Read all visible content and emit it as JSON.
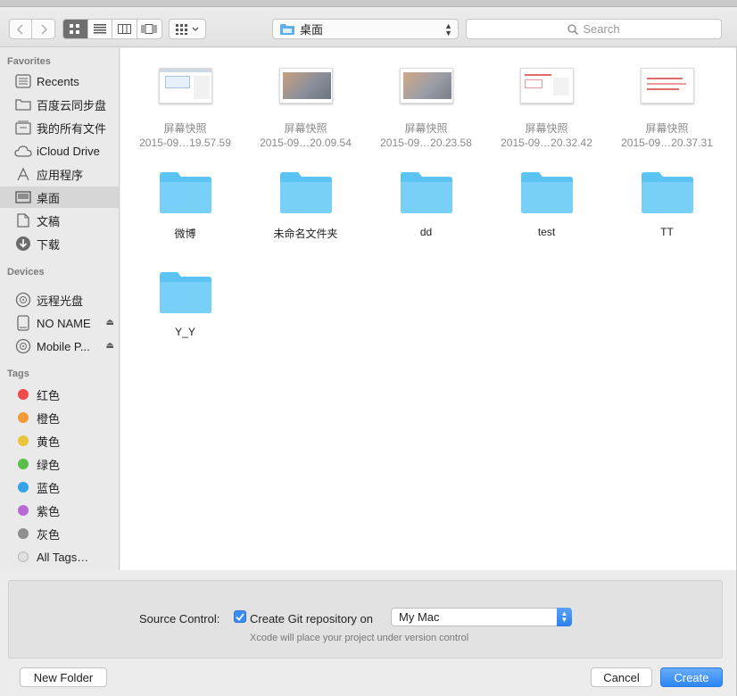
{
  "toolbar": {
    "path_label": "桌面",
    "search_placeholder": "Search"
  },
  "sidebar": {
    "favorites_title": "Favorites",
    "favorites": [
      {
        "label": "Recents",
        "icon": "recents-icon"
      },
      {
        "label": "百度云同步盘",
        "icon": "folder-icon"
      },
      {
        "label": "我的所有文件",
        "icon": "all-files-icon"
      },
      {
        "label": "iCloud Drive",
        "icon": "cloud-icon"
      },
      {
        "label": "应用程序",
        "icon": "applications-icon"
      },
      {
        "label": "桌面",
        "icon": "desktop-icon",
        "selected": true
      },
      {
        "label": "文稿",
        "icon": "documents-icon"
      },
      {
        "label": "下载",
        "icon": "downloads-icon"
      }
    ],
    "devices_title": "Devices",
    "devices": [
      {
        "label": "远程光盘",
        "icon": "disc-icon"
      },
      {
        "label": "NO NAME",
        "icon": "drive-icon",
        "eject": true
      },
      {
        "label": "Mobile P...",
        "icon": "disc-icon",
        "eject": true
      }
    ],
    "tags_title": "Tags",
    "tags": [
      {
        "label": "红色",
        "color": "#ef4a4a"
      },
      {
        "label": "橙色",
        "color": "#f19a37"
      },
      {
        "label": "黄色",
        "color": "#e9c53b"
      },
      {
        "label": "绿色",
        "color": "#5dbd4b"
      },
      {
        "label": "蓝色",
        "color": "#35a3e8"
      },
      {
        "label": "紫色",
        "color": "#b86ad2"
      },
      {
        "label": "灰色",
        "color": "#8e8e8e"
      },
      {
        "label": "All Tags…",
        "color": "#e0e0e0"
      }
    ]
  },
  "files": [
    {
      "name": "屏幕快照",
      "date": "2015-09…19.57.59"
    },
    {
      "name": "屏幕快照",
      "date": "2015-09…20.09.54"
    },
    {
      "name": "屏幕快照",
      "date": "2015-09…20.23.58"
    },
    {
      "name": "屏幕快照",
      "date": "2015-09…20.32.42"
    },
    {
      "name": "屏幕快照",
      "date": "2015-09…20.37.31"
    }
  ],
  "folders": [
    "微博",
    "未命名文件夹",
    "dd",
    "test",
    "TT",
    "Y_Y"
  ],
  "options": {
    "source_control_label": "Source Control:",
    "create_git_label": "Create Git repository on",
    "git_checked": true,
    "location_value": "My Mac",
    "hint": "Xcode will place your project under version control"
  },
  "buttons": {
    "new_folder": "New Folder",
    "cancel": "Cancel",
    "create": "Create"
  },
  "colors": {
    "accent": "#2d86f2",
    "folder": "#5cc3f5"
  }
}
